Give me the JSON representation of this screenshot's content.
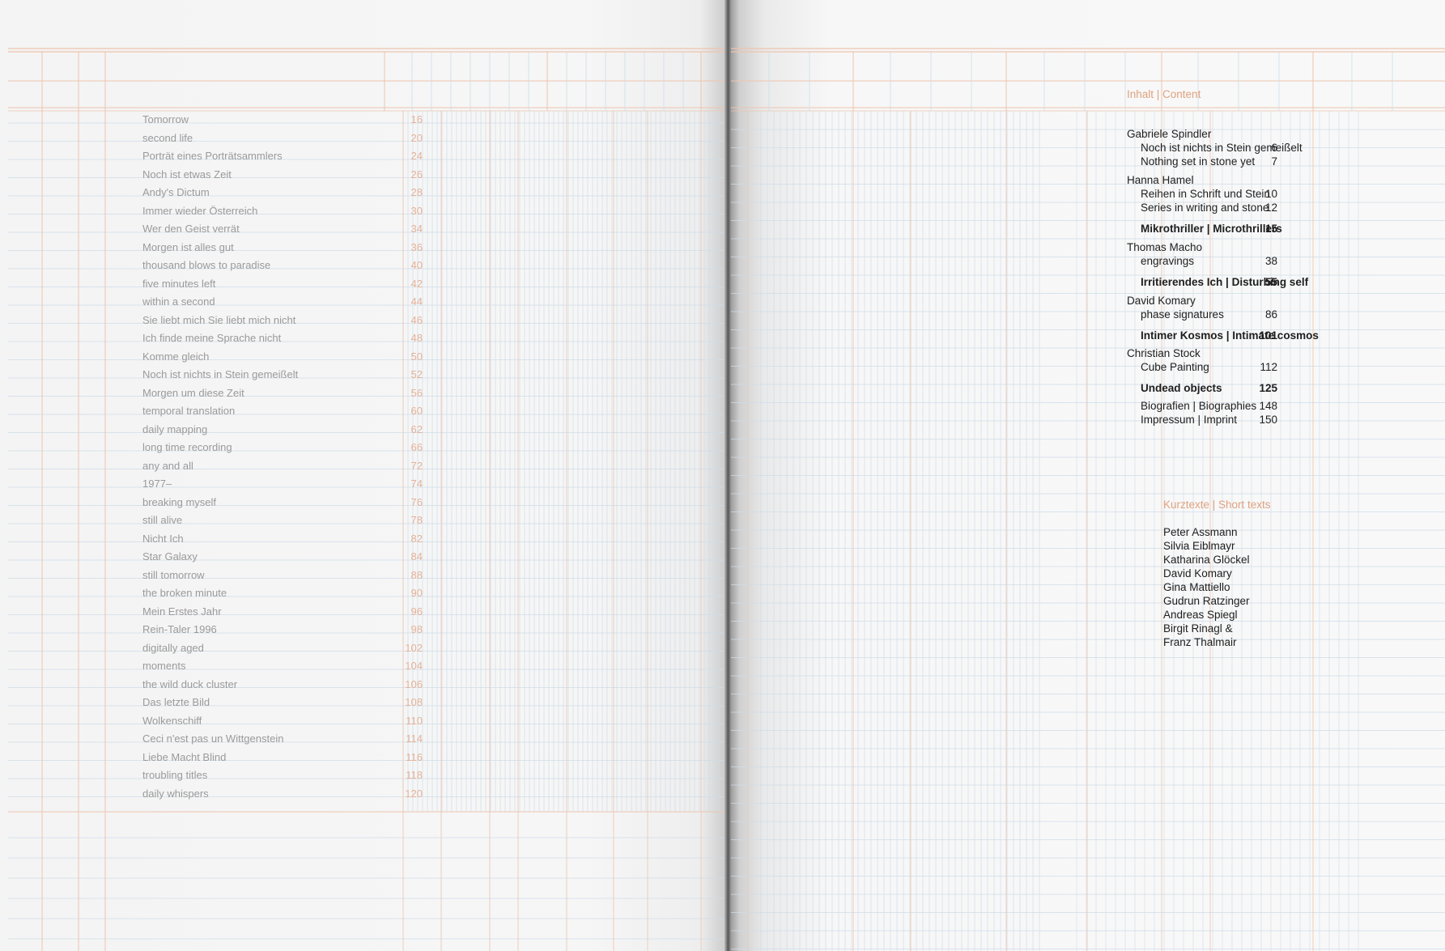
{
  "left_page": {
    "titles": [
      {
        "title": "Tomorrow",
        "page": "16"
      },
      {
        "title": "second life",
        "page": "20"
      },
      {
        "title": "Porträt eines Porträtsammlers",
        "page": "24"
      },
      {
        "title": "Noch ist etwas Zeit",
        "page": "26"
      },
      {
        "title": "Andy's Dictum",
        "page": "28"
      },
      {
        "title": "Immer wieder Österreich",
        "page": "30"
      },
      {
        "title": "Wer den Geist verrät",
        "page": "34"
      },
      {
        "title": "Morgen ist alles gut",
        "page": "36"
      },
      {
        "title": "thousand blows to paradise",
        "page": "40"
      },
      {
        "title": "five minutes left",
        "page": "42"
      },
      {
        "title": "within a second",
        "page": "44"
      },
      {
        "title": "Sie liebt mich Sie liebt mich nicht",
        "page": "46"
      },
      {
        "title": "Ich finde meine Sprache nicht",
        "page": "48"
      },
      {
        "title": "Komme gleich",
        "page": "50"
      },
      {
        "title": "Noch ist nichts in Stein gemeißelt",
        "page": "52"
      },
      {
        "title": "Morgen um diese Zeit",
        "page": "56"
      },
      {
        "title": "temporal translation",
        "page": "60"
      },
      {
        "title": "daily mapping",
        "page": "62"
      },
      {
        "title": "long time recording",
        "page": "66"
      },
      {
        "title": "any and all",
        "page": "72"
      },
      {
        "title": "1977–",
        "page": "74"
      },
      {
        "title": "breaking myself",
        "page": "76"
      },
      {
        "title": "still alive",
        "page": "78"
      },
      {
        "title": "Nicht Ich",
        "page": "82"
      },
      {
        "title": "Star Galaxy",
        "page": "84"
      },
      {
        "title": "still tomorrow",
        "page": "88"
      },
      {
        "title": "the broken minute",
        "page": "90"
      },
      {
        "title": "Mein Erstes Jahr",
        "page": "96"
      },
      {
        "title": "Rein-Taler 1996",
        "page": "98"
      },
      {
        "title": "digitally aged",
        "page": "102"
      },
      {
        "title": "moments",
        "page": "104"
      },
      {
        "title": "the wild duck cluster",
        "page": "106"
      },
      {
        "title": "Das letzte Bild",
        "page": "108"
      },
      {
        "title": "Wolkenschiff",
        "page": "110"
      },
      {
        "title": "Ceci n'est pas un Wittgenstein",
        "page": "114"
      },
      {
        "title": "Liebe Macht Blind",
        "page": "116"
      },
      {
        "title": "troubling titles",
        "page": "118"
      },
      {
        "title": "daily whispers",
        "page": "120"
      }
    ]
  },
  "right_page": {
    "heading": "Inhalt | Content",
    "toc": {
      "spindler_author": "Gabriele Spindler",
      "spindler_t1": "Noch ist nichts in Stein gemeißelt",
      "spindler_p1": "6",
      "spindler_t2": "Nothing set in stone yet",
      "spindler_p2": "7",
      "hamel_author": "Hanna Hamel",
      "hamel_t1": "Reihen in Schrift und Stein",
      "hamel_p1": "10",
      "hamel_t2": "Series in writing and stone",
      "hamel_p2": "12",
      "section1": "Mikrothriller | Microthrillers",
      "section1_p": "15",
      "macho_author": "Thomas Macho",
      "macho_t1": "engravings",
      "macho_p1": "38",
      "section2": "Irritierendes Ich | Disturbing self",
      "section2_p": "55",
      "komary_author": "David Komary",
      "komary_t1": "phase signatures",
      "komary_p1": "86",
      "section3": "Intimer Kosmos | Intimate cosmos",
      "section3_p": "101",
      "stock_author": "Christian Stock",
      "stock_t1": "Cube Painting",
      "stock_p1": "112",
      "section4": "Undead objects",
      "section4_p": "125",
      "bio": "Biografien | Biographies",
      "bio_p": "148",
      "imprint": "Impressum | Imprint",
      "imprint_p": "150"
    },
    "short_texts_heading": "Kurztexte | Short texts",
    "short_texts": [
      "Peter Assmann",
      "Silvia Eiblmayr",
      "Katharina Glöckel",
      "David Komary",
      "Gina Mattiello",
      "Gudrun Ratzinger",
      "Andreas Spiegl",
      "Birgit Rinagl &",
      "Franz Thalmair"
    ],
    "colors": {
      "accent": "#e0a27f",
      "grid_orange": "#edc4ae",
      "grid_blue": "#cfdde8",
      "text": "#1e1e1e",
      "muted": "#9a9a9a"
    }
  }
}
